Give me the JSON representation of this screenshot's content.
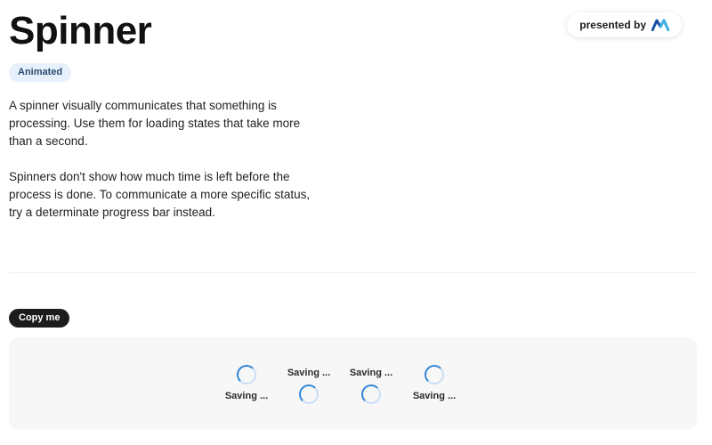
{
  "header": {
    "title": "Spinner",
    "tag": "Animated",
    "presented_by": "presented by",
    "logo_icon": "brand-logo-icon"
  },
  "description": {
    "paragraph_1": "A spinner visually communicates that something is processing.  Use them for loading states that take more than a second.",
    "paragraph_2": "Spinners don't show how much time is left before the process is done. To communicate a more specific status, try a determinate progress bar instead."
  },
  "copy_button": {
    "label": "Copy me"
  },
  "demo": {
    "spinners": [
      {
        "label": "Saving ...",
        "label_position": "below"
      },
      {
        "label": "Saving ...",
        "label_position": "above"
      },
      {
        "label": "Saving ...",
        "label_position": "above"
      },
      {
        "label": "Saving ...",
        "label_position": "below"
      }
    ]
  },
  "colors": {
    "spinner_accent": "#2f86d6",
    "spinner_track": "#c9def4",
    "tag_background": "#e6f1fb",
    "button_background": "#1c1c1c",
    "demo_background": "#f7f7f7"
  }
}
